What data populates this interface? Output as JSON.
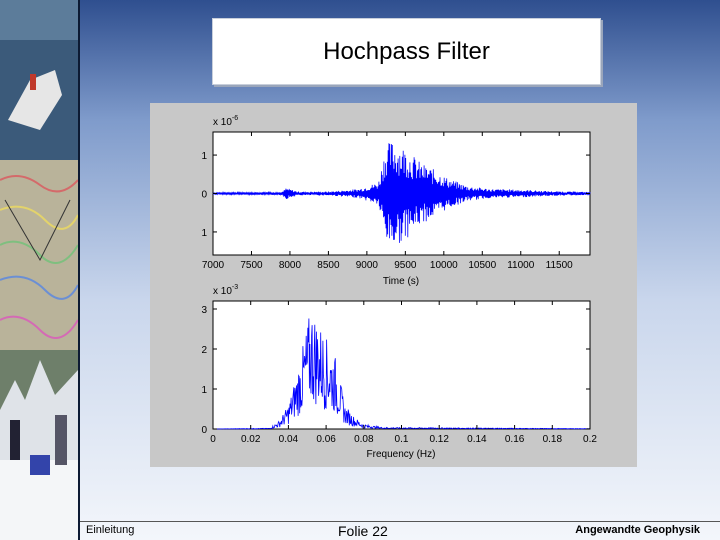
{
  "slide": {
    "title": "Hochpass Filter",
    "footer_left": "Einleitung",
    "footer_center": "Folie 22",
    "footer_right": "Angewandte Geophysik"
  },
  "colors": {
    "background_top": "#2f4f8f",
    "background_bottom": "#f3f6fb",
    "figure_bg": "#c8c8c8",
    "trace": "#0000ff"
  },
  "chart_data": [
    {
      "type": "line",
      "xlabel": "Time (s)",
      "ylabel": "",
      "exponent_label": "x 10",
      "exponent": "-6",
      "xlim": [
        7000,
        11900
      ],
      "ylim": [
        -1.6,
        1.6
      ],
      "xticks": [
        7000,
        7500,
        8000,
        8500,
        9000,
        9500,
        10000,
        10500,
        11000,
        11500
      ],
      "xtick_labels": [
        "7000",
        "7500",
        "8000",
        "8500",
        "9000",
        "9500",
        "10000",
        "10500",
        "11000",
        "11500"
      ],
      "yticks": [
        1,
        0,
        -1
      ],
      "ytick_labels": [
        "1",
        "0",
        "1"
      ],
      "envelope": [
        {
          "x": 7000,
          "amp": 0.02
        },
        {
          "x": 7900,
          "amp": 0.04
        },
        {
          "x": 7950,
          "amp": 0.15
        },
        {
          "x": 8100,
          "amp": 0.05
        },
        {
          "x": 8500,
          "amp": 0.05
        },
        {
          "x": 8900,
          "amp": 0.12
        },
        {
          "x": 9150,
          "amp": 0.3
        },
        {
          "x": 9250,
          "amp": 1.3
        },
        {
          "x": 9350,
          "amp": 1.4
        },
        {
          "x": 9500,
          "amp": 1.2
        },
        {
          "x": 9700,
          "amp": 0.8
        },
        {
          "x": 9900,
          "amp": 0.6
        },
        {
          "x": 10050,
          "amp": 0.4
        },
        {
          "x": 10300,
          "amp": 0.2
        },
        {
          "x": 10600,
          "amp": 0.12
        },
        {
          "x": 11000,
          "amp": 0.1
        },
        {
          "x": 11400,
          "amp": 0.06
        },
        {
          "x": 11900,
          "amp": 0.04
        }
      ]
    },
    {
      "type": "line",
      "xlabel": "Frequency (Hz)",
      "ylabel": "",
      "exponent_label": "x 10",
      "exponent": "-3",
      "xlim": [
        0,
        0.2
      ],
      "ylim": [
        0,
        3.2
      ],
      "xticks": [
        0,
        0.02,
        0.04,
        0.06,
        0.08,
        0.1,
        0.12,
        0.14,
        0.16,
        0.18,
        0.2
      ],
      "xtick_labels": [
        "0",
        "0.02",
        "0.04",
        "0.06",
        "0.08",
        "0.1",
        "0.12",
        "0.14",
        "0.16",
        "0.18",
        "0.2"
      ],
      "yticks": [
        0,
        1,
        2,
        3
      ],
      "ytick_labels": [
        "0",
        "1",
        "2",
        "3"
      ],
      "envelope": [
        {
          "x": 0.0,
          "amp": 0.0
        },
        {
          "x": 0.03,
          "amp": 0.02
        },
        {
          "x": 0.035,
          "amp": 0.2
        },
        {
          "x": 0.04,
          "amp": 0.6
        },
        {
          "x": 0.045,
          "amp": 1.5
        },
        {
          "x": 0.05,
          "amp": 2.6
        },
        {
          "x": 0.052,
          "amp": 3.1
        },
        {
          "x": 0.056,
          "amp": 2.7
        },
        {
          "x": 0.06,
          "amp": 2.3
        },
        {
          "x": 0.065,
          "amp": 1.8
        },
        {
          "x": 0.07,
          "amp": 0.6
        },
        {
          "x": 0.075,
          "amp": 0.3
        },
        {
          "x": 0.08,
          "amp": 0.12
        },
        {
          "x": 0.09,
          "amp": 0.04
        },
        {
          "x": 0.2,
          "amp": 0.01
        }
      ]
    }
  ]
}
